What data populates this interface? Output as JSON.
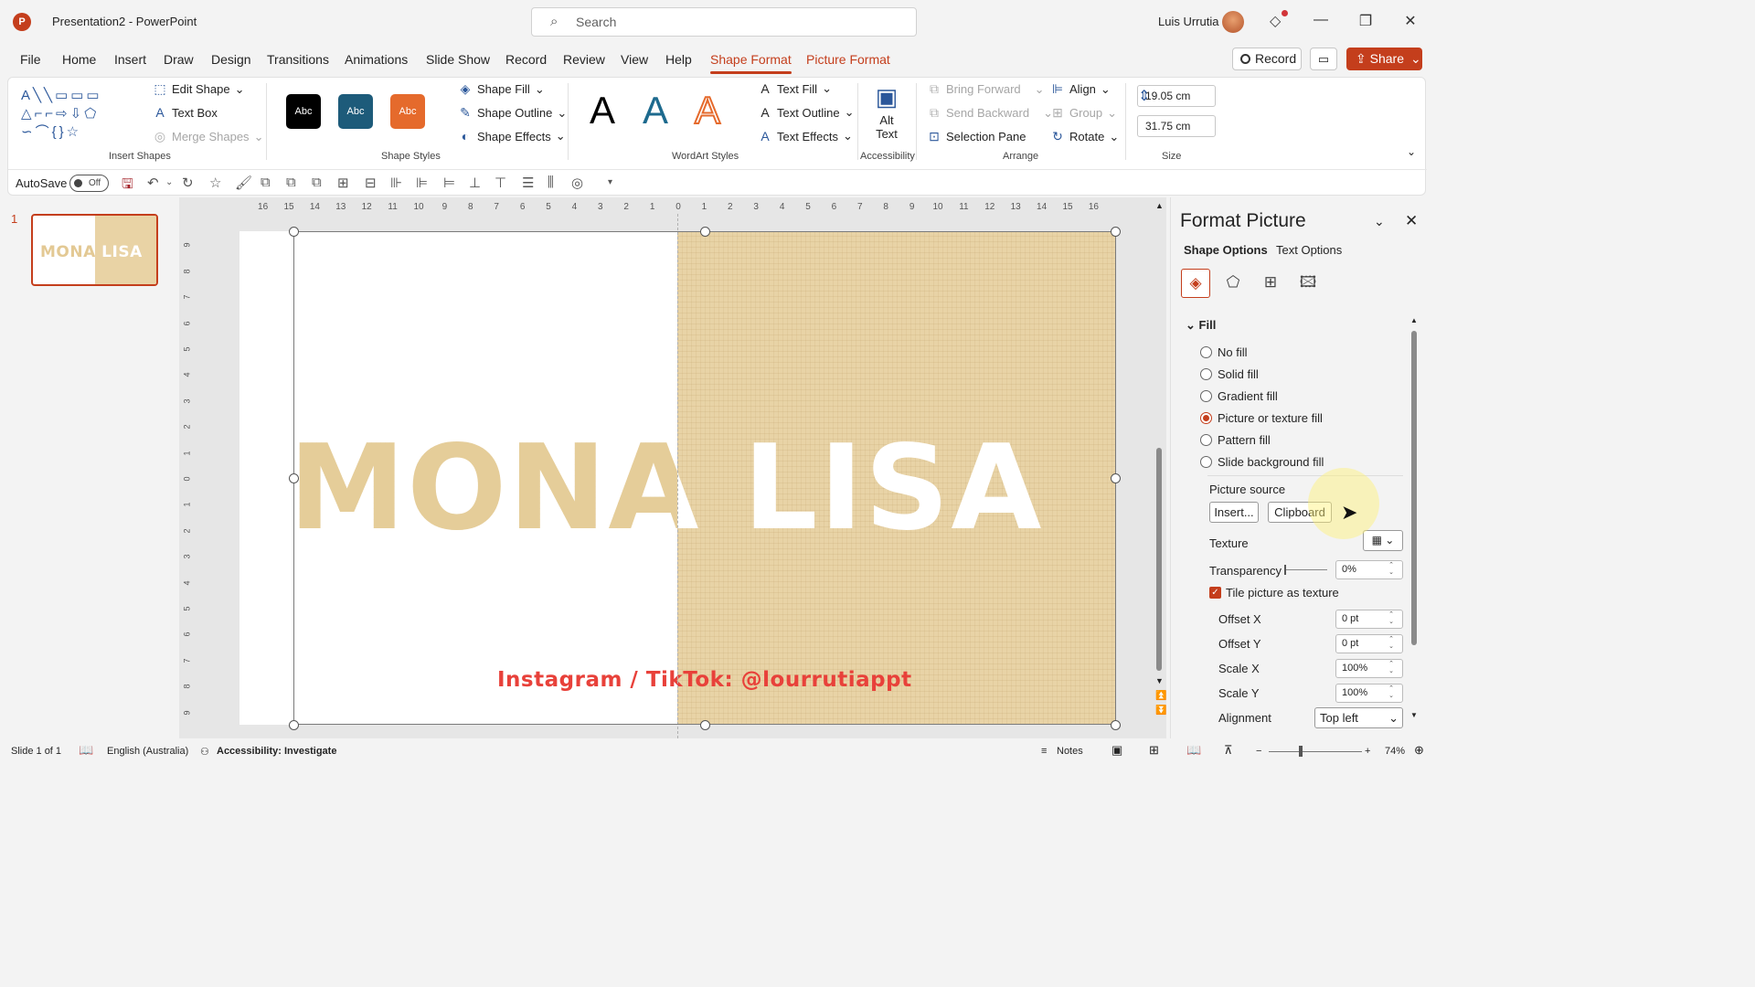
{
  "titlebar": {
    "doc_title": "Presentation2  -  PowerPoint",
    "search_placeholder": "Search",
    "user_name": "Luis Urrutia"
  },
  "menu": {
    "tabs": [
      "File",
      "Home",
      "Insert",
      "Draw",
      "Design",
      "Transitions",
      "Animations",
      "Slide Show",
      "Record",
      "Review",
      "View",
      "Help",
      "Shape Format",
      "Picture Format"
    ],
    "active_tab": "Shape Format",
    "record_label": "Record",
    "share_label": "Share"
  },
  "ribbon": {
    "insert_shapes": {
      "label": "Insert Shapes",
      "edit_shape": "Edit Shape",
      "text_box": "Text Box",
      "merge_shapes": "Merge Shapes"
    },
    "shape_styles": {
      "label": "Shape Styles",
      "swatch_text": "Abc",
      "shape_fill": "Shape Fill",
      "shape_outline": "Shape Outline",
      "shape_effects": "Shape Effects"
    },
    "wordart_styles": {
      "label": "WordArt Styles",
      "letter": "A",
      "text_fill": "Text Fill",
      "text_outline": "Text Outline",
      "text_effects": "Text Effects"
    },
    "accessibility": {
      "label": "Accessibility",
      "alt_text": "Alt Text"
    },
    "arrange": {
      "label": "Arrange",
      "bring_forward": "Bring Forward",
      "send_backward": "Send Backward",
      "selection_pane": "Selection Pane",
      "align": "Align",
      "group": "Group",
      "rotate": "Rotate"
    },
    "size": {
      "label": "Size",
      "height": "19.05 cm",
      "width": "31.75 cm"
    }
  },
  "qat": {
    "autosave_label": "AutoSave",
    "autosave_state": "Off"
  },
  "thumbnails": [
    {
      "number": "1",
      "text": "MONA LISA"
    }
  ],
  "ruler": {
    "h_ticks": [
      "16",
      "15",
      "14",
      "13",
      "12",
      "11",
      "10",
      "9",
      "8",
      "7",
      "6",
      "5",
      "4",
      "3",
      "2",
      "1",
      "0",
      "1",
      "2",
      "3",
      "4",
      "5",
      "6",
      "7",
      "8",
      "9",
      "10",
      "11",
      "12",
      "13",
      "14",
      "15",
      "16"
    ],
    "v_ticks": [
      "9",
      "8",
      "7",
      "6",
      "5",
      "4",
      "3",
      "2",
      "1",
      "0",
      "1",
      "2",
      "3",
      "4",
      "5",
      "6",
      "7",
      "8",
      "9"
    ]
  },
  "slide": {
    "title": "MONA LISA",
    "handle_text": "Instagram / TikTok: @lourrutiappt"
  },
  "format_pane": {
    "title": "Format Picture",
    "tabs": [
      "Shape Options",
      "Text Options"
    ],
    "section": "Fill",
    "fill_options": [
      "No fill",
      "Solid fill",
      "Gradient fill",
      "Picture or texture fill",
      "Pattern fill",
      "Slide background fill"
    ],
    "selected_fill": "Picture or texture fill",
    "picture_source_label": "Picture source",
    "insert_btn": "Insert...",
    "clipboard_btn": "Clipboard",
    "texture_label": "Texture",
    "transparency_label": "Transparency",
    "transparency_value": "0%",
    "tile_label": "Tile picture as texture",
    "tile_checked": true,
    "offset_x_label": "Offset X",
    "offset_x": "0 pt",
    "offset_y_label": "Offset Y",
    "offset_y": "0 pt",
    "scale_x_label": "Scale X",
    "scale_x": "100%",
    "scale_y_label": "Scale Y",
    "scale_y": "100%",
    "alignment_label": "Alignment",
    "alignment_value": "Top left"
  },
  "statusbar": {
    "slide_info": "Slide 1 of 1",
    "language": "English (Australia)",
    "accessibility": "Accessibility: Investigate",
    "notes": "Notes",
    "zoom": "74%"
  },
  "colors": {
    "accent": "#c43e1c",
    "texture": "#e8d3a6",
    "handle_text": "#e8413a"
  }
}
